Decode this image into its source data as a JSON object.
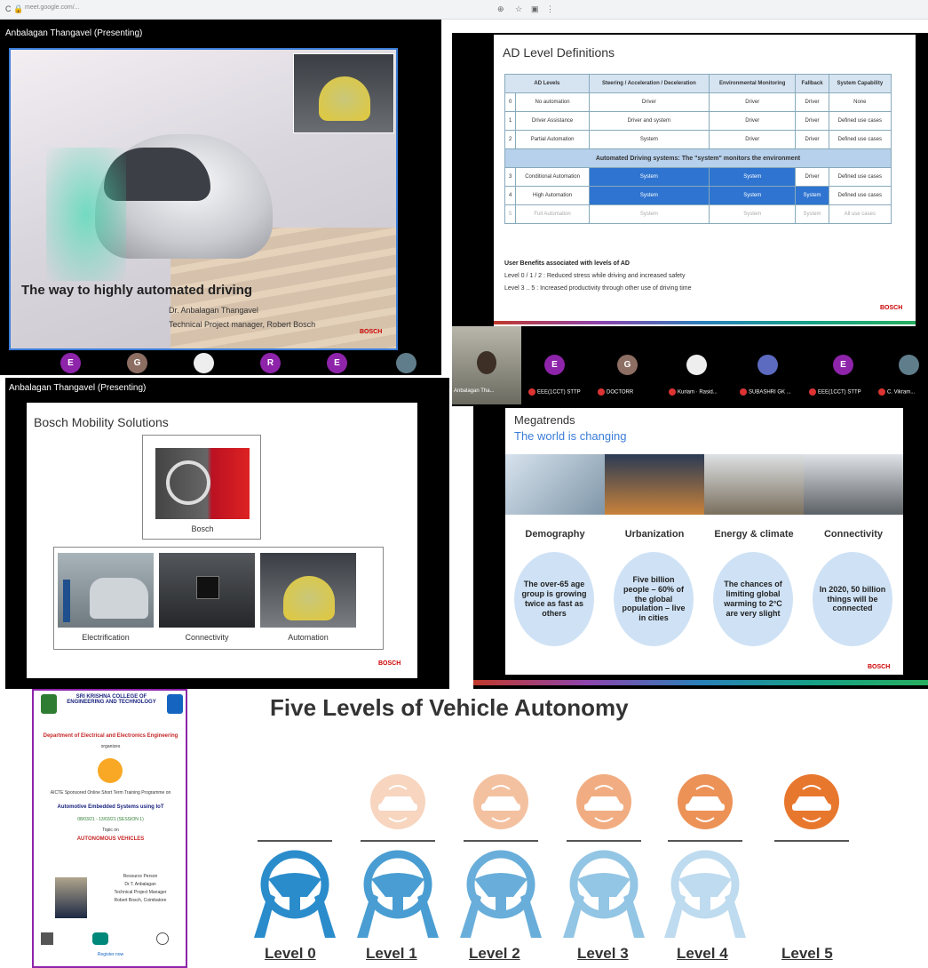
{
  "browser": {
    "url": "meet.google.com/...",
    "nav": "C  🔒"
  },
  "pane1": {
    "title": "Anbalagan Thangavel (Presenting)",
    "slide_heading": "The way to highly automated driving",
    "presenter_line1": "Dr. Anbalagan Thangavel",
    "presenter_line2": "Technical Project manager, Robert Bosch",
    "brand": "BOSCH"
  },
  "pane2": {
    "slide_title": "AD Level Definitions",
    "headers": [
      "AD Levels",
      "Steering / Acceleration / Deceleration",
      "Environmental Monitoring",
      "Fallback",
      "System Capability"
    ],
    "rows": [
      [
        "0",
        "No automation",
        "Driver",
        "Driver",
        "Driver",
        "None"
      ],
      [
        "1",
        "Driver Assistance",
        "Driver and system",
        "Driver",
        "Driver",
        "Defined use cases"
      ],
      [
        "2",
        "Partial Automation",
        "System",
        "Driver",
        "Driver",
        "Defined use cases"
      ]
    ],
    "band": "Automated Driving systems: The \"system\" monitors the environment",
    "rows2": [
      [
        "3",
        "Conditional Automation",
        "System",
        "System",
        "Driver",
        "Defined use cases"
      ],
      [
        "4",
        "High Automation",
        "System",
        "System",
        "System",
        "Defined use cases"
      ],
      [
        "5",
        "Full Automation",
        "System",
        "System",
        "System",
        "All use cases"
      ]
    ],
    "benefits_title": "User Benefits associated with levels of AD",
    "benefit1": "Level 0 / 1 / 2 : Reduced stress while driving and increased safety",
    "benefit2": "Level 3 .. 5 : Increased productivity through other use of driving time",
    "brand": "BOSCH"
  },
  "strip1": {
    "participants": [
      "E",
      "G",
      "",
      "R",
      "E",
      ""
    ]
  },
  "strip2": {
    "names": [
      "Anbalagan Tha...",
      "EEE(1CCT) STTP",
      "DOCTORR",
      "Kuriam · Rasid...",
      "SUBASHRI GK ...",
      "EEE(1CCT) STTP",
      "C. Vikram..."
    ],
    "avatars": [
      "E",
      "G",
      "",
      "",
      "E",
      ""
    ]
  },
  "pane3": {
    "title": "Anbalagan Thangavel (Presenting)",
    "slide_title": "Bosch Mobility Solutions",
    "top_caption": "Bosch",
    "captions": [
      "Electrification",
      "Connectivity",
      "Automation"
    ],
    "brand": "BOSCH"
  },
  "pane4": {
    "slide_title": "Megatrends",
    "subtitle": "The world is changing",
    "columns": [
      {
        "head": "Demography",
        "bubble": "The over-65 age group is growing twice as fast as others"
      },
      {
        "head": "Urbanization",
        "bubble": "Five billion people – 60% of the global population – live in cities"
      },
      {
        "head": "Energy & climate",
        "bubble": "The chances of limiting global warming to 2°C are very slight"
      },
      {
        "head": "Connectivity",
        "bubble": "In 2020, 50 billion things will be connected"
      }
    ],
    "brand": "BOSCH"
  },
  "poster": {
    "college": "SRI KRISHNA COLLEGE OF ENGINEERING AND TECHNOLOGY",
    "dept": "Department of Electrical and Electronics Engineering",
    "org": "organizes",
    "program": "AICTE Sponsored Online Short Term Training Programme on",
    "topic": "Automotive Embedded Systems using IoT",
    "date": "08/03/21 - 13/03/21 (SESSION 1)",
    "topic2": "Topic on",
    "session": "AUTONOMOUS VEHICLES",
    "speaker": "Resource Person",
    "speaker_name": "Dr.T. Anbalagan",
    "speaker_role": "Technical Project Manager",
    "speaker_org": "Robert Bosch, Coimbatore",
    "footer": "Register now"
  },
  "levels": {
    "title": "Five Levels of Vehicle Autonomy",
    "labels": [
      "Level 0",
      "Level 1",
      "Level 2",
      "Level 3",
      "Level 4",
      "Level 5"
    ],
    "car_opacity": [
      0,
      0.3,
      0.45,
      0.6,
      0.8,
      1
    ],
    "wheel_opacity": [
      1,
      0.85,
      0.7,
      0.5,
      0.3,
      0
    ],
    "car_color": "#e8772e",
    "wheel_color": "#2a8ccb"
  }
}
